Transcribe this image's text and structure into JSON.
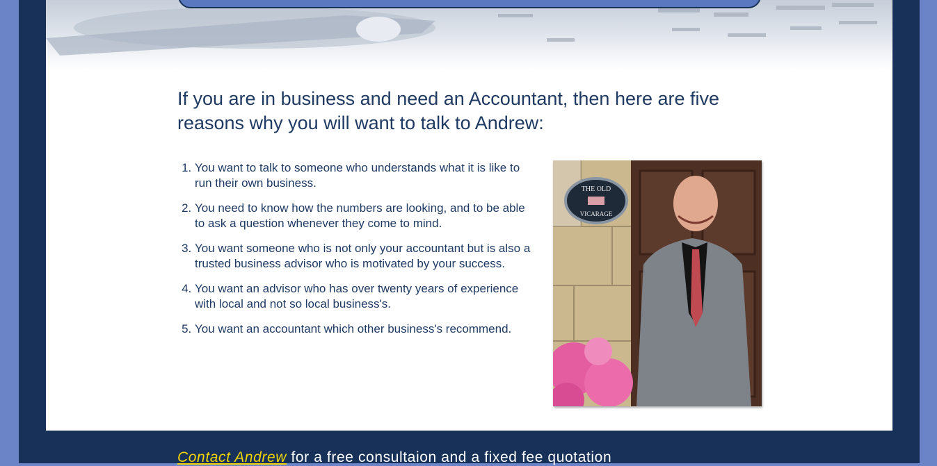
{
  "headline": "If you are in business and need an Accountant, then here are five reasons why you will want to talk to Andrew:",
  "reasons": [
    "You want to talk to someone who understands what it is like to run their own business.",
    "You need to know how the numbers are looking, and to be able to ask a question whenever they come to mind.",
    "You want someone who is not only your accountant but is also a trusted business advisor who is motivated by your success.",
    "You want an advisor who has over twenty years of experience with local and not so local business's.",
    "You want an accountant which other business's recommend."
  ],
  "photo": {
    "sign_line1": "THE OLD",
    "sign_line2": "VICARAGE"
  },
  "footer": {
    "link": "Contact Andrew",
    "text": " for a free consultaion and a fixed fee quotation"
  },
  "colors": {
    "outer_bg": "#6b84c8",
    "frame": "#173158",
    "text": "#1f3a63",
    "link": "#f2d400"
  }
}
